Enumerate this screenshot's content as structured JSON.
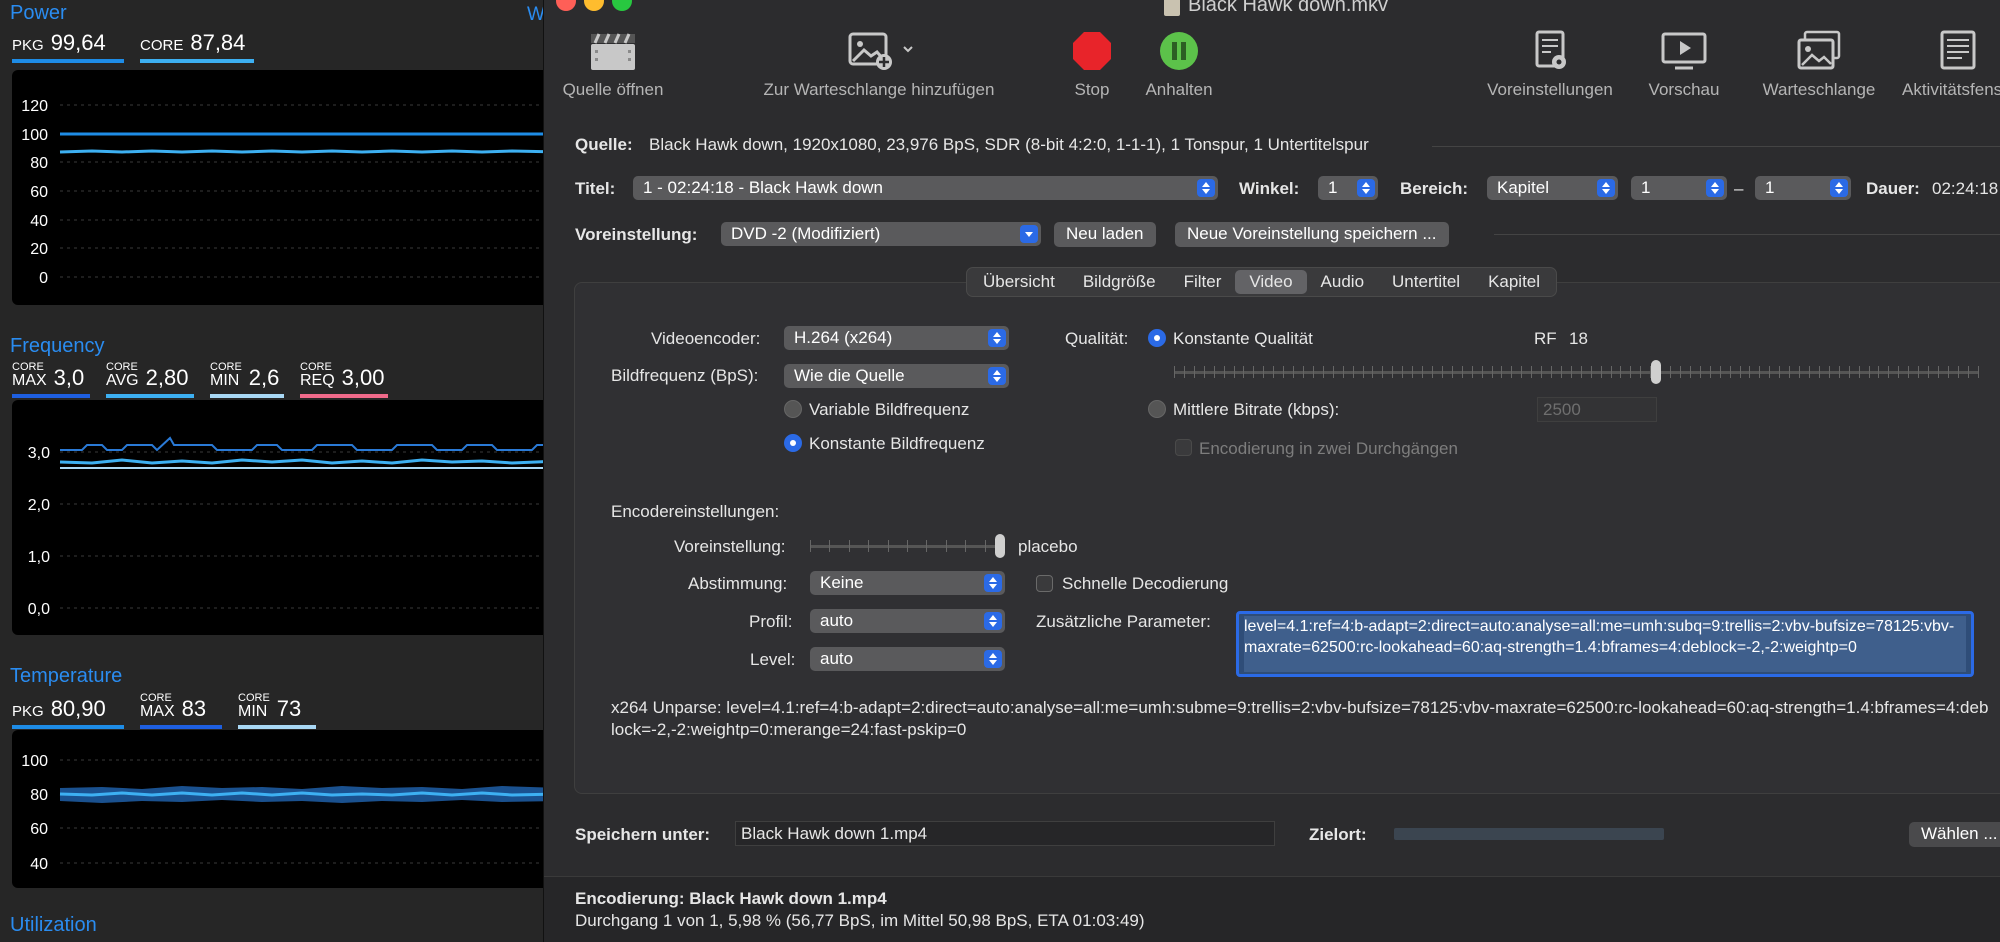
{
  "monitor": {
    "power": {
      "title": "Power",
      "metrics": [
        {
          "label": "PKG",
          "value": "99,64",
          "color": "#1e8ce6"
        },
        {
          "label": "CORE",
          "value": "87,84",
          "color": "#3db0f2"
        }
      ],
      "yticks": [
        "120",
        "100",
        "80",
        "60",
        "40",
        "20",
        "0"
      ]
    },
    "frequency": {
      "title": "Frequency",
      "metrics": [
        {
          "label_top": "CORE",
          "label": "MAX",
          "value": "3,0",
          "color": "#1e5fe0"
        },
        {
          "label_top": "CORE",
          "label": "AVG",
          "value": "2,80",
          "color": "#3db0f2"
        },
        {
          "label_top": "CORE",
          "label": "MIN",
          "value": "2,6",
          "color": "#a9d8f5"
        },
        {
          "label_top": "CORE",
          "label": "REQ",
          "value": "3,00",
          "color": "#f06a8a"
        }
      ],
      "yticks": [
        "3,0",
        "2,0",
        "1,0",
        "0,0"
      ]
    },
    "temperature": {
      "title": "Temperature",
      "metrics": [
        {
          "label": "PKG",
          "value": "80,90",
          "color": "#1e8ce6"
        },
        {
          "label_top": "CORE",
          "label": "MAX",
          "value": "83",
          "color": "#1e5fe0"
        },
        {
          "label_top": "CORE",
          "label": "MIN",
          "value": "73",
          "color": "#a9d8f5"
        }
      ],
      "yticks": [
        "100",
        "80",
        "60",
        "40"
      ]
    },
    "utilization": {
      "title": "Utilization"
    },
    "clipped_label": "W"
  },
  "window": {
    "title": "Black Hawk down.mkv",
    "toolbar": {
      "open_source": "Quelle öffnen",
      "add_queue": "Zur Warteschlange hinzufügen",
      "stop": "Stop",
      "pause": "Anhalten",
      "presets": "Voreinstellungen",
      "preview": "Vorschau",
      "queue": "Warteschlange",
      "activity": "Aktivitätsfens"
    },
    "source": {
      "label": "Quelle:",
      "value": "Black Hawk down, 1920x1080, 23,976 BpS, SDR (8-bit 4:2:0, 1-1-1), 1 Tonspur, 1 Untertitelspur"
    },
    "title_row": {
      "label": "Titel:",
      "title_value": "1 - 02:24:18 - Black Hawk down",
      "angle_label": "Winkel:",
      "angle_value": "1",
      "range_label": "Bereich:",
      "range_type": "Kapitel",
      "range_from": "1",
      "range_dash": "–",
      "range_to": "1",
      "duration_label": "Dauer:",
      "duration_value": "02:24:18"
    },
    "preset_row": {
      "label": "Voreinstellung:",
      "value": "DVD -2 (Modifiziert)",
      "reload": "Neu laden",
      "save_new": "Neue Voreinstellung speichern ..."
    },
    "tabs": [
      "Übersicht",
      "Bildgröße",
      "Filter",
      "Video",
      "Audio",
      "Untertitel",
      "Kapitel"
    ],
    "selected_tab": "Video",
    "video": {
      "encoder_label": "Videoencoder:",
      "encoder_value": "H.264 (x264)",
      "framerate_label": "Bildfrequenz (BpS):",
      "framerate_value": "Wie die Quelle",
      "vfr_label": "Variable Bildfrequenz",
      "cfr_label": "Konstante Bildfrequenz",
      "quality_label": "Qualität:",
      "const_quality_label": "Konstante Qualität",
      "rf_label": "RF",
      "rf_value": "18",
      "rf_fraction": 0.6,
      "avg_bitrate_label": "Mittlere Bitrate (kbps):",
      "bitrate_value": "2500",
      "two_pass_label": "Encodierung in zwei Durchgängen",
      "encoder_settings_label": "Encodereinstellungen:",
      "enc_preset_label": "Voreinstellung:",
      "enc_preset_value": "placebo",
      "enc_preset_fraction": 1.0,
      "tune_label": "Abstimmung:",
      "tune_value": "Keine",
      "fast_decode_label": "Schnelle Decodierung",
      "profile_label": "Profil:",
      "profile_value": "auto",
      "level_label": "Level:",
      "level_value": "auto",
      "extra_params_label": "Zusätzliche Parameter:",
      "extra_params_value": "level=4.1:ref=4:b-adapt=2:direct=auto:analyse=all:me=umh:subq=9:trellis=2:vbv-bufsize=78125:vbv-maxrate=62500:rc-lookahead=60:aq-strength=1.4:bframes=4:deblock=-2,-2:weightp=0",
      "unparse_text": "x264 Unparse: level=4.1:ref=4:b-adapt=2:direct=auto:analyse=all:me=umh:subme=9:trellis=2:vbv-bufsize=78125:vbv-maxrate=62500:rc-lookahead=60:aq-strength=1.4:bframes=4:deblock=-2,-2:weightp=0:merange=24:fast-pskip=0"
    },
    "save": {
      "label": "Speichern unter:",
      "value": "Black Hawk down 1.mp4",
      "dest_label": "Zielort:",
      "choose": "Wählen ..."
    },
    "status": {
      "line1": "Encodierung: Black Hawk down 1.mp4",
      "line2": "Durchgang 1 von 1, 5,98 %  (56,77 BpS, im Mittel 50,98 BpS, ETA 01:03:49)"
    }
  }
}
